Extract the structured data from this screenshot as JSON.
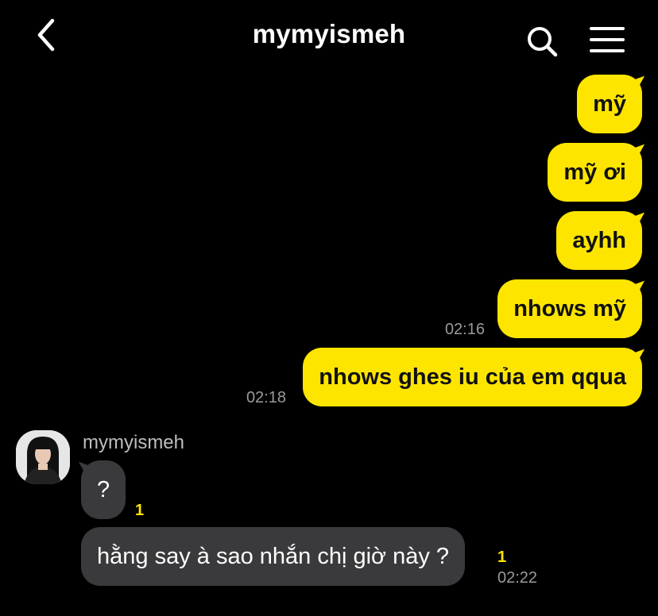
{
  "header": {
    "title": "mymyismeh"
  },
  "messages_out": [
    {
      "text": "mỹ"
    },
    {
      "text": "mỹ ơi"
    },
    {
      "text": "ayhh"
    },
    {
      "text": "nhows mỹ",
      "time": "02:16"
    },
    {
      "text": "nhows ghes iu của em qqua",
      "time": "02:18"
    }
  ],
  "incoming": {
    "sender": "mymyismeh",
    "messages": [
      {
        "text": "?",
        "unread": "1"
      },
      {
        "text": "hằng say à sao nhắn chị giờ này ?",
        "unread": "1",
        "time": "02:22"
      }
    ]
  },
  "colors": {
    "background": "#000000",
    "outgoing_bubble": "#FEE500",
    "incoming_bubble": "#3a3a3c",
    "unread_count": "#FEE500"
  },
  "icons": {
    "back": "chevron-left-icon",
    "search": "search-icon",
    "menu": "hamburger-menu-icon"
  }
}
